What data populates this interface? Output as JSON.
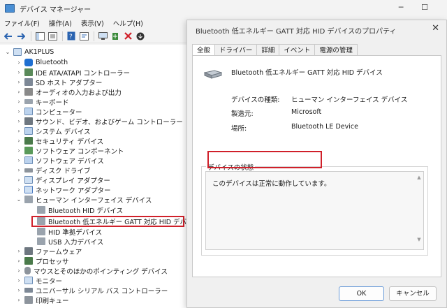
{
  "window": {
    "title": "デバイス マネージャー",
    "minimize": "─",
    "maximize": "☐"
  },
  "menu": [
    "ファイル(F)",
    "操作(A)",
    "表示(V)",
    "ヘルプ(H)"
  ],
  "tree": {
    "root": "AK1PLUS",
    "items": [
      "Bluetooth",
      "IDE ATA/ATAPI コントローラー",
      "SD ホスト アダプター",
      "オーディオの入力および出力",
      "キーボード",
      "コンピューター",
      "サウンド、ビデオ、およびゲーム コントローラー",
      "システム デバイス",
      "セキュリティ デバイス",
      "ソフトウェア コンポーネント",
      "ソフトウェア デバイス",
      "ディスク ドライブ",
      "ディスプレイ アダプター",
      "ネットワーク アダプター",
      "ヒューマン インターフェイス デバイス"
    ],
    "hid_children": [
      "Bluetooth HID デバイス",
      "Bluetooth 低エネルギー GATT 対応 HID デバイス",
      "HID 準拠デバイス",
      "USB 入力デバイス"
    ],
    "after_items": [
      "ファームウェア",
      "プロセッサ",
      "マウスとそのほかのポインティング デバイス",
      "モニター",
      "ユニバーサル シリアル バス コントローラー",
      "印刷キュー"
    ]
  },
  "dialog": {
    "title": "Bluetooth 低エネルギー GATT 対応 HID デバイスのプロパティ",
    "close": "✕",
    "tabs": [
      "全般",
      "ドライバー",
      "詳細",
      "イベント",
      "電源の管理"
    ],
    "device_name": "Bluetooth 低エネルギー GATT 対応 HID デバイス",
    "properties": [
      {
        "label": "デバイスの種類:",
        "value": "ヒューマン インターフェイス デバイス"
      },
      {
        "label": "製造元:",
        "value": "Microsoft"
      },
      {
        "label": "場所:",
        "value": "Bluetooth LE Device"
      }
    ],
    "status_legend": "デバイスの状態",
    "status_text": "このデバイスは正常に動作しています。",
    "ok": "OK",
    "cancel": "キャンセル"
  },
  "colors": {
    "highlight": "#d0202a",
    "accent": "#4a8fd4"
  }
}
